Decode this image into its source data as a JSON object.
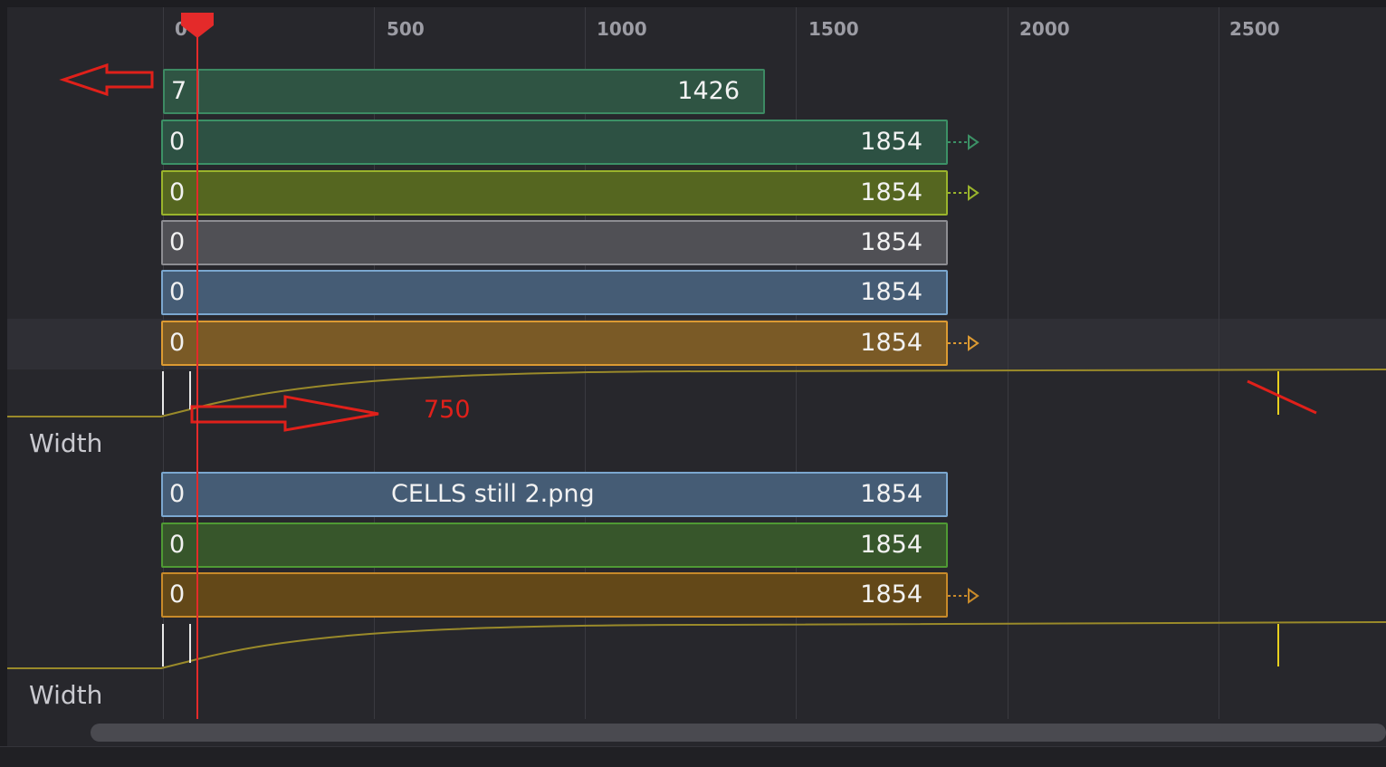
{
  "ruler": {
    "ticks": [
      "0",
      "500",
      "1000",
      "1500",
      "2000",
      "2500"
    ],
    "playhead_color": "#e42a2a"
  },
  "clips": [
    {
      "start": "7",
      "end": "1426",
      "name": "",
      "color": "green-teal"
    },
    {
      "start": "0",
      "end": "1854",
      "name": "",
      "color": "green-teal"
    },
    {
      "start": "0",
      "end": "1854",
      "name": "",
      "color": "olive"
    },
    {
      "start": "0",
      "end": "1854",
      "name": "",
      "color": "gray"
    },
    {
      "start": "0",
      "end": "1854",
      "name": "",
      "color": "blue"
    },
    {
      "start": "0",
      "end": "1854",
      "name": "",
      "color": "orange"
    },
    {
      "start": "0",
      "end": "1854",
      "name": "CELLS still 2.png",
      "color": "blue"
    },
    {
      "start": "0",
      "end": "1854",
      "name": "",
      "color": "green"
    },
    {
      "start": "0",
      "end": "1854",
      "name": "",
      "color": "orange"
    }
  ],
  "curves": [
    {
      "label": "Width"
    },
    {
      "label": "Width"
    }
  ],
  "annotation": {
    "value_text": "750",
    "color": "#e0201a"
  }
}
